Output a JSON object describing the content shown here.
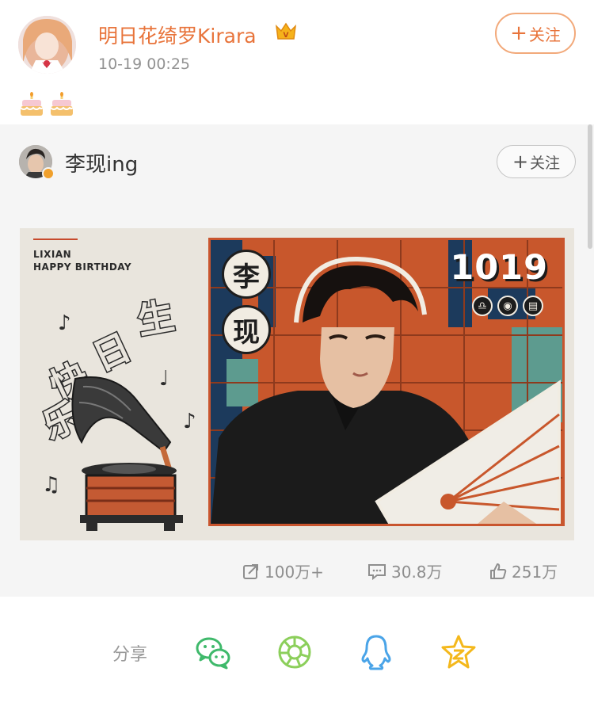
{
  "author": {
    "name": "明日花绮罗Kirara",
    "time": "10-19 00:25",
    "follow_label": "关注"
  },
  "post": {
    "emojis": [
      "birthday-cake",
      "birthday-cake"
    ]
  },
  "repost": {
    "author_name": "李现ing",
    "follow_label": "关注",
    "poster": {
      "line1": "LIXIAN",
      "line2": "HAPPY BIRTHDAY",
      "date": "1019",
      "name_char_1": "李",
      "name_char_2": "现"
    },
    "stats": {
      "reposts": "100万+",
      "comments": "30.8万",
      "likes": "251万"
    }
  },
  "share": {
    "label": "分享",
    "targets": [
      "wechat",
      "moments",
      "qq",
      "qzone"
    ]
  },
  "colors": {
    "accent": "#e8743b",
    "repost_bg": "#f5f5f5",
    "wechat": "#3fb96b",
    "moments": "#8ccf5b",
    "qq": "#4aa4e8",
    "qzone": "#f4b81c"
  }
}
